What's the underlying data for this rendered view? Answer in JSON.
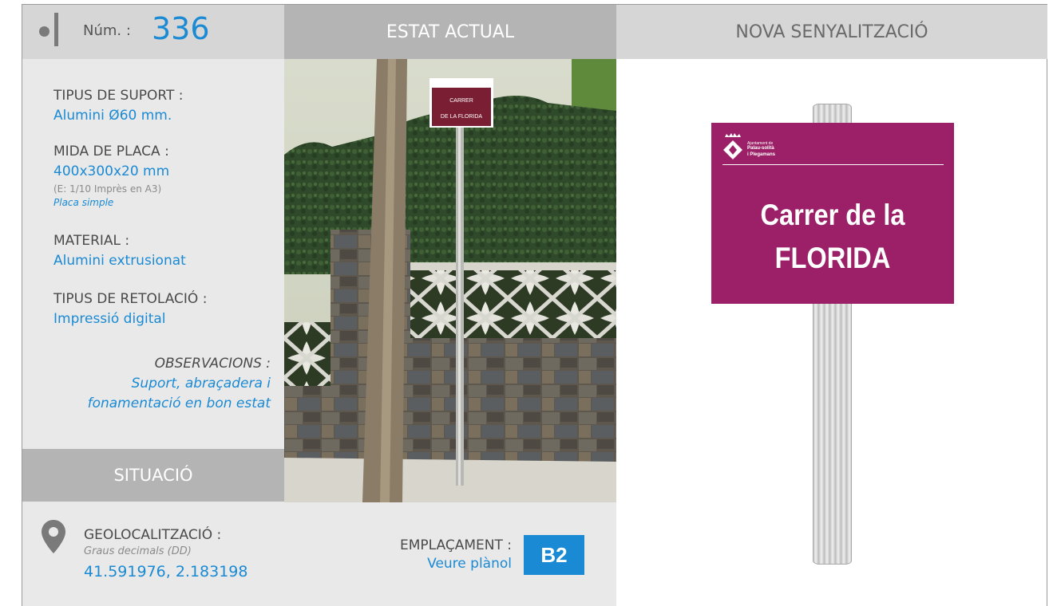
{
  "header": {
    "num_label": "Núm. :",
    "num_value": "336",
    "estat_title": "ESTAT ACTUAL",
    "nova_title": "NOVA SENYALITZACIÓ"
  },
  "fields": {
    "suport_title": "TIPUS DE SUPORT :",
    "suport_value": "Alumini Ø60 mm.",
    "mida_title": "MIDA DE PLACA :",
    "mida_value": "400x300x20 mm",
    "mida_note": "(E: 1/10 Imprès en A3)",
    "mida_type": "Placa simple",
    "material_title": "MATERIAL :",
    "material_value": "Alumini extrusionat",
    "retolacio_title": "TIPUS DE RETOLACIÓ :",
    "retolacio_value": "Impressió digital",
    "obs_title": "OBSERVACIONS :",
    "obs_line1": "Suport, abraçadera i",
    "obs_line2": "fonamentació en bon estat"
  },
  "situacio": {
    "title": "SITUACIÓ",
    "geo_title": "GEOLOCALITZACIÓ :",
    "geo_sub": "Graus decimals (DD)",
    "geo_value": "41.591976, 2.183198",
    "empl_title": "EMPLAÇAMENT :",
    "empl_value": "Veure plànol",
    "empl_code": "B2"
  },
  "photo": {
    "sign_line1": "CARRER",
    "sign_line2": "DE LA FLORIDA"
  },
  "new_sign": {
    "org_line1": "Ajuntament de",
    "org_line2": "Palau-solità",
    "org_line3": "i Plegamans",
    "text_line1": "Carrer de la",
    "text_line2": "FLORIDA"
  },
  "colors": {
    "accent": "#1a8ad4",
    "sign_color": "#9b2067"
  }
}
